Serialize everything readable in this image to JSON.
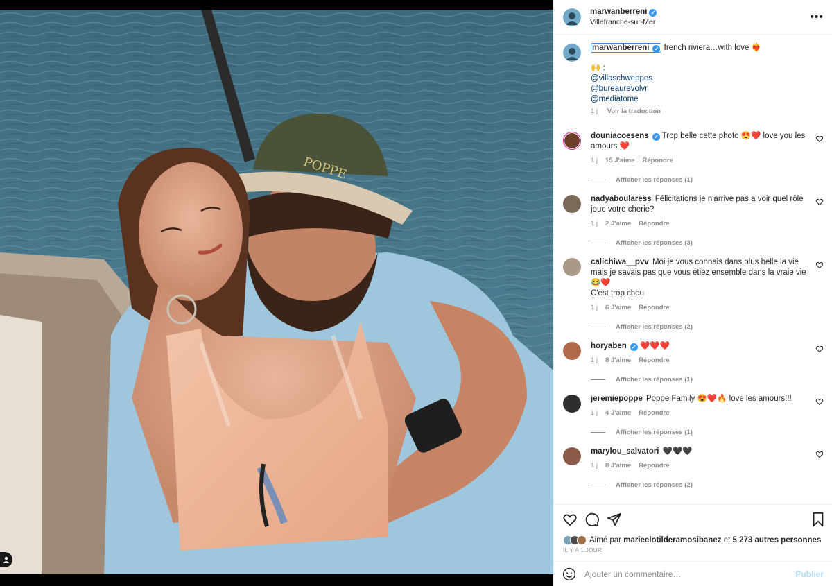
{
  "post_author": {
    "username": "marwanberreni",
    "verified_icon": "verified-badge-icon",
    "location": "Villefranche-sur-Mer"
  },
  "caption": {
    "username": "marwanberreni",
    "text": "french riviera…with love ❤️‍🔥",
    "line2": "🙌 :",
    "mentions": [
      "@villaschweppes",
      "@bureaurevolvr",
      "@mediatome"
    ],
    "time": "1 j",
    "translate": "Voir la traduction"
  },
  "comments": [
    {
      "username": "douniacoesens",
      "verified": true,
      "text": "Trop belle cette photo 😍❤️ love you les amours ❤️",
      "time": "1 j",
      "likes": "15 J'aime",
      "reply": "Répondre",
      "replies": "Afficher les réponses (1)",
      "avatar_color": "#6b3f2a"
    },
    {
      "username": "nadyaboularess",
      "verified": false,
      "text": "Félicitations je n'arrive pas a voir quel rôle joue votre cherie?",
      "time": "1 j",
      "likes": "2 J'aime",
      "reply": "Répondre",
      "replies": "Afficher les réponses (3)",
      "avatar_color": "#7a6a5a"
    },
    {
      "username": "calichiwa__pvv",
      "verified": false,
      "text": "Moi je vous connais dans plus belle la vie mais je savais pas que vous étiez ensemble dans la vraie vie 😂❤️",
      "text2": "C'est trop chou",
      "time": "1 j",
      "likes": "6 J'aime",
      "reply": "Répondre",
      "replies": "Afficher les réponses (2)",
      "avatar_color": "#a89888"
    },
    {
      "username": "horyaben",
      "verified": true,
      "text": "❤️❤️❤️",
      "time": "1 j",
      "likes": "8 J'aime",
      "reply": "Répondre",
      "replies": "Afficher les réponses (1)",
      "avatar_color": "#b06a4a"
    },
    {
      "username": "jeremiepoppe",
      "verified": false,
      "text": "Poppe Family 😍❤️🔥 love les amours!!!",
      "time": "1 j",
      "likes": "4 J'aime",
      "reply": "Répondre",
      "replies": "Afficher les réponses (1)",
      "avatar_color": "#2e2e2e"
    },
    {
      "username": "marylou_salvatori",
      "verified": false,
      "text": "🖤🖤🖤",
      "time": "1 j",
      "likes": "8 J'aime",
      "reply": "Répondre",
      "replies": "Afficher les réponses (2)",
      "avatar_color": "#8a5a4a"
    }
  ],
  "actions": {
    "icons": [
      "heart-icon",
      "comment-icon",
      "share-icon",
      "bookmark-icon"
    ],
    "likes_prefix": "Aimé par",
    "liked_by": "marieclotilderamosibanez",
    "likes_joiner": "et",
    "others": "5 273 autres personnes",
    "ago": "IL Y A 1 JOUR"
  },
  "add_comment": {
    "placeholder": "Ajouter un commentaire…",
    "publish": "Publier"
  }
}
